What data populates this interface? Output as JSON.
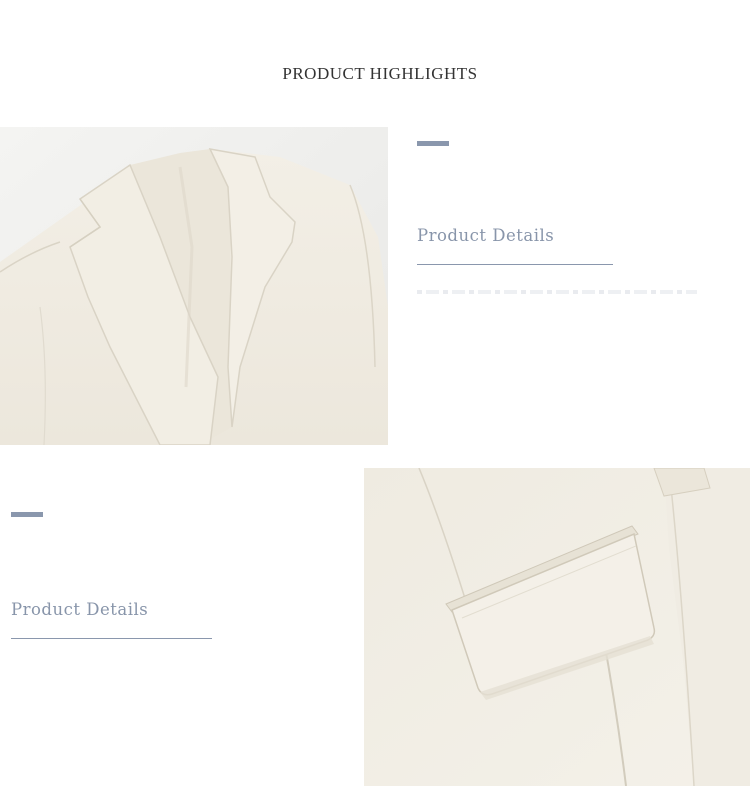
{
  "page": {
    "title": "PRODUCT HIGHLIGHTS"
  },
  "sections": [
    {
      "heading": "Product Details",
      "image": "blazer-collar-closeup"
    },
    {
      "heading": "Product Details",
      "image": "blazer-pocket-flap-closeup"
    }
  ],
  "colors": {
    "accent": "#8a97ad",
    "heading": "#8895aa",
    "fabric": "#f1ede3",
    "background": "#ffffff"
  }
}
